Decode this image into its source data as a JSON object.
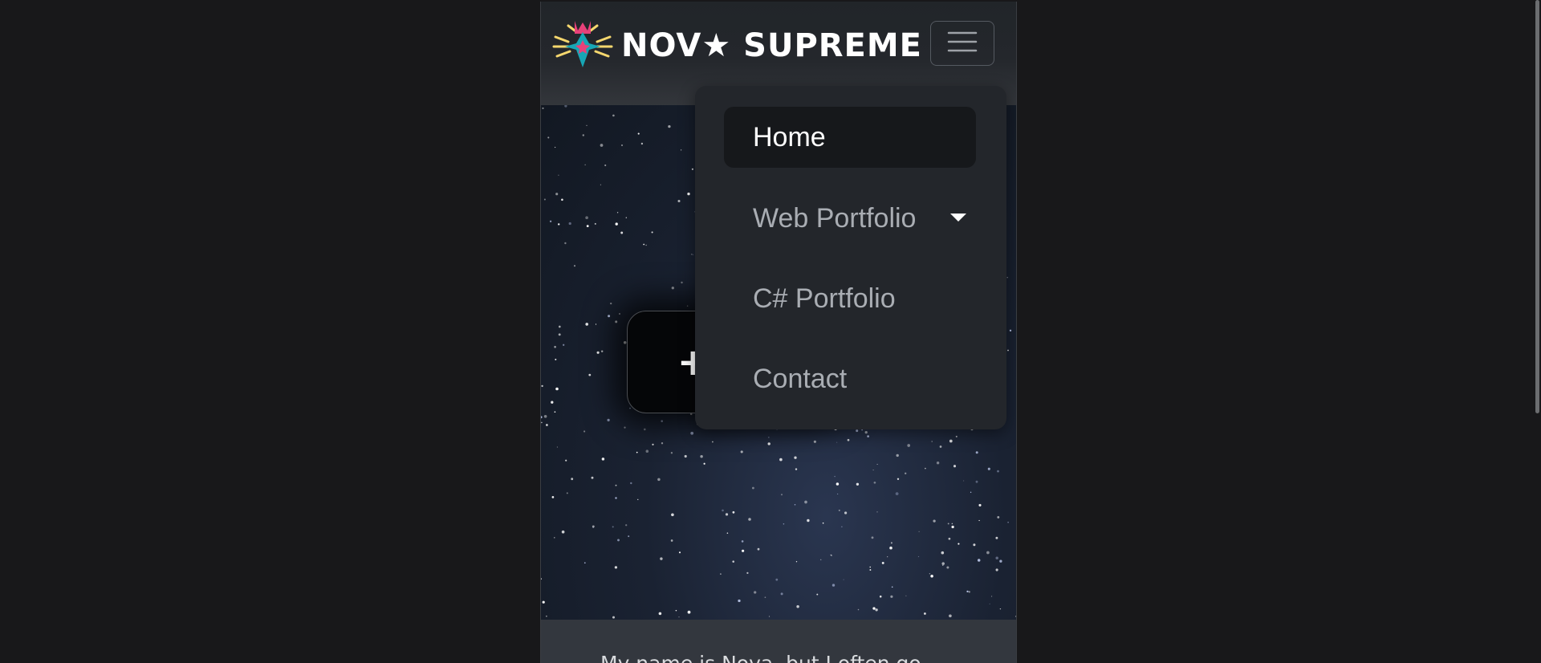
{
  "navbar": {
    "brand_title": "NOV★ SUPREME",
    "logo_icon": "star-crown-logo",
    "toggler_icon": "hamburger-icon"
  },
  "menu": {
    "items": [
      {
        "label": "Home",
        "active": true
      },
      {
        "label": "Web Portfolio",
        "has_dropdown": true
      },
      {
        "label": "C# Portfolio"
      },
      {
        "label": "Contact"
      }
    ]
  },
  "hero": {
    "card_text": "+"
  },
  "about": {
    "text": "My name is Nova, but I often go"
  },
  "colors": {
    "page_bg": "#18181a",
    "navbar_bg": "#212529",
    "menu_bg": "#23262b",
    "active_item_bg": "#16181b",
    "logo_pink": "#e8417a",
    "logo_teal": "#17a6b5",
    "logo_yellow": "#f5d76e"
  }
}
